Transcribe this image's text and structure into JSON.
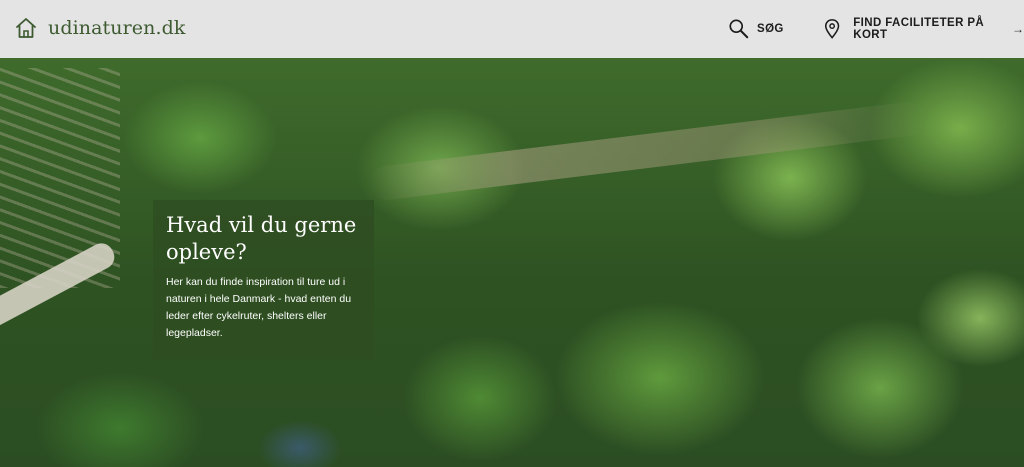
{
  "header": {
    "logo_text": "udinaturen.dk",
    "logo_icon": "home-icon",
    "search_label": "SØG",
    "search_icon": "search-icon",
    "map_label": "FIND FACILITETER PÅ KORT",
    "map_icon": "map-pin-icon",
    "map_arrow": "→"
  },
  "hero": {
    "title": "Hvad vil du gerne opleve?",
    "text": "Her kan du finde inspiration til ture ud i naturen i hele Danmark - hvad enten du leder efter cykelruter, shelters eller legepladser."
  },
  "colors": {
    "header_bg": "#e4e4e4",
    "brand_green": "#3d5a30",
    "card_bg": "#2f4e22"
  }
}
